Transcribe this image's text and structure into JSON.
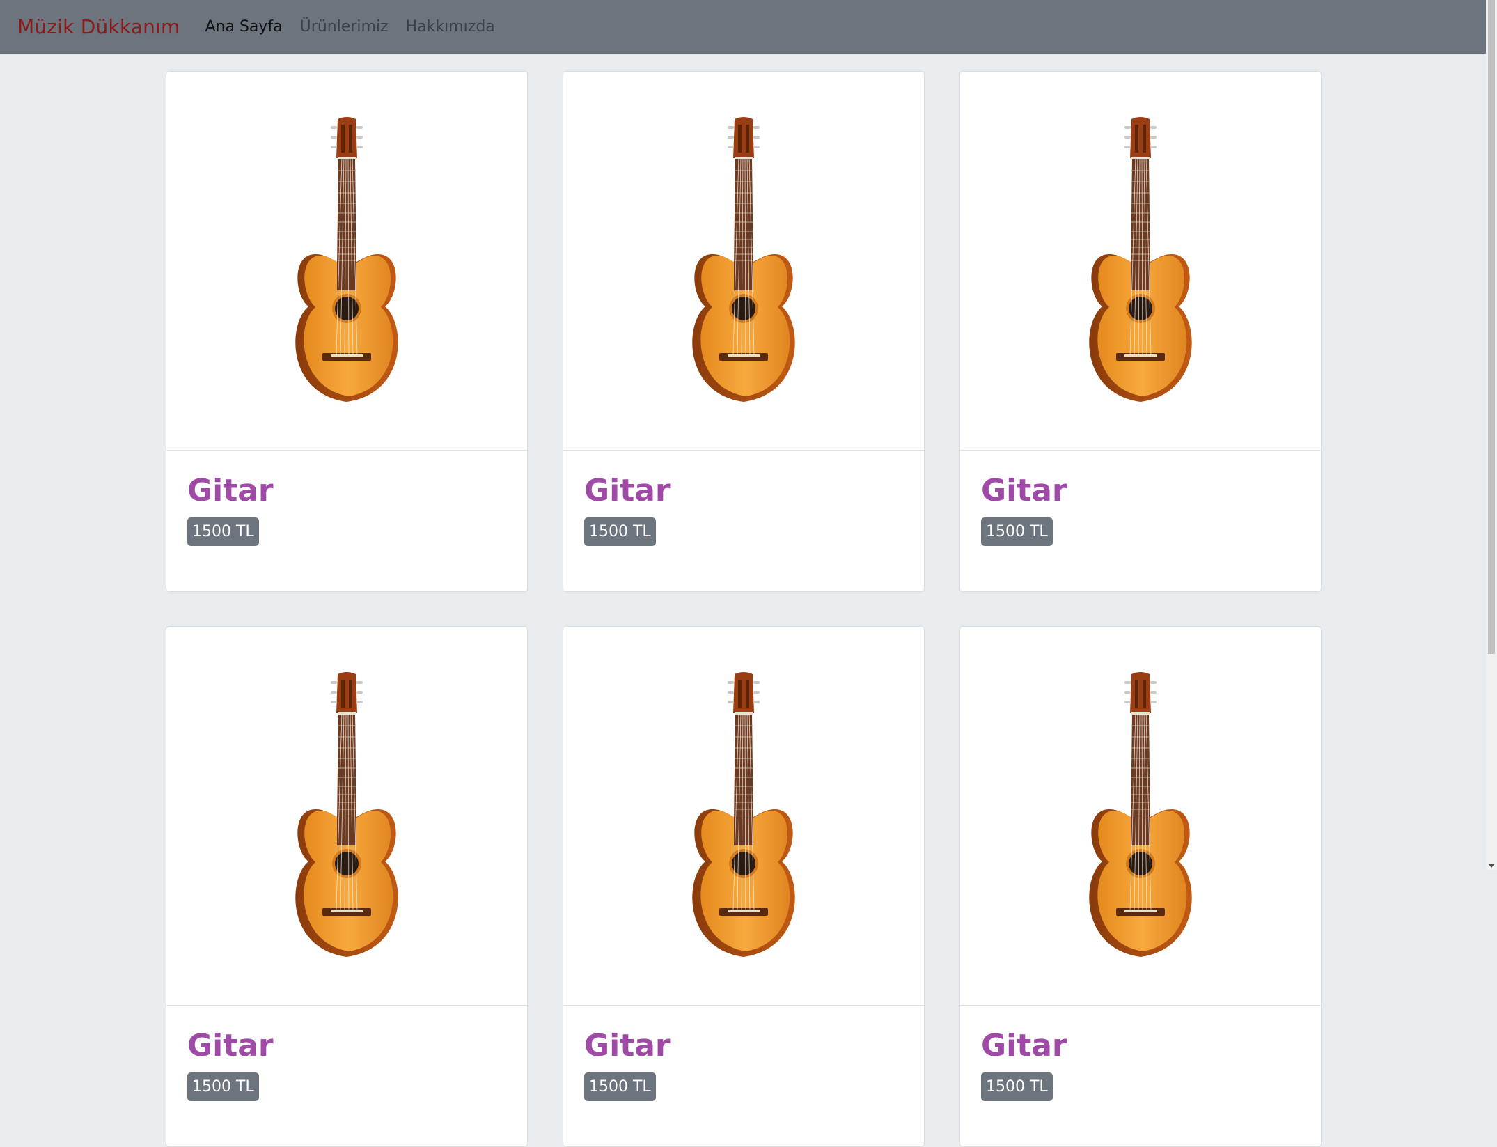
{
  "nav": {
    "brand": "Müzik Dükkanım",
    "links": [
      {
        "label": "Ana Sayfa",
        "active": true
      },
      {
        "label": "Ürünlerimiz",
        "active": false
      },
      {
        "label": "Hakkımızda",
        "active": false
      }
    ]
  },
  "products": [
    {
      "name": "Gitar",
      "price": "1500 TL",
      "icon": "guitar-image"
    },
    {
      "name": "Gitar",
      "price": "1500 TL",
      "icon": "guitar-image"
    },
    {
      "name": "Gitar",
      "price": "1500 TL",
      "icon": "guitar-image"
    },
    {
      "name": "Gitar",
      "price": "1500 TL",
      "icon": "guitar-image"
    },
    {
      "name": "Gitar",
      "price": "1500 TL",
      "icon": "guitar-image"
    },
    {
      "name": "Gitar",
      "price": "1500 TL",
      "icon": "guitar-image"
    }
  ],
  "colors": {
    "navbar": "#6c757d",
    "brand": "#8b1a1a",
    "title": "#a04aa8",
    "badge": "#6c757d",
    "page_bg": "#e9ecef"
  }
}
